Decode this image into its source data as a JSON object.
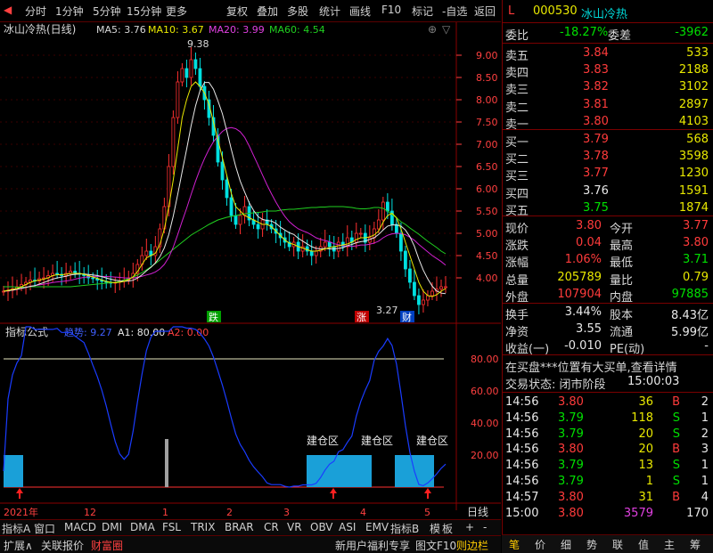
{
  "toolbar": {
    "left": [
      "分时",
      "1分钟",
      "5分钟",
      "15分钟",
      "更多"
    ],
    "right": [
      "复权",
      "叠加",
      "多股",
      "统计",
      "画线",
      "F10",
      "标记",
      "-自选",
      "返回"
    ]
  },
  "main_chart": {
    "title": "冰山冷热(日线)",
    "ma5": "MA5: 3.76",
    "ma10": "MA10: 3.67",
    "ma20": "MA20: 3.99",
    "ma60": "MA60: 4.54",
    "high_label": "9.38",
    "low_label": "3.27",
    "y_ticks": [
      "9.00",
      "8.50",
      "8.00",
      "7.50",
      "7.00",
      "6.50",
      "6.00",
      "5.50",
      "5.00",
      "4.50",
      "4.00"
    ],
    "markers": [
      "跌",
      "涨",
      "财"
    ]
  },
  "indicator": {
    "title": "指标公式",
    "v1": "趋势: 9.27",
    "v2": "A1: 80.00",
    "v3": "A2: 0.00",
    "y_ticks": [
      "80.00",
      "60.00",
      "40.00",
      "20.00"
    ],
    "build_label": "建仓区"
  },
  "x_axis": {
    "labels": [
      "2021年",
      "12",
      "1",
      "2",
      "3",
      "4",
      "5"
    ],
    "right": "日线"
  },
  "chart_data": {
    "type": "line",
    "series": [
      {
        "close": [
          3.7,
          3.72,
          3.75,
          3.8,
          3.85,
          3.9,
          3.95,
          3.93,
          3.98,
          4.0,
          4.05,
          4.1,
          4.08,
          4.05,
          4.1,
          4.15,
          4.1,
          4.08,
          4.05,
          4.0,
          3.98,
          3.95,
          3.92,
          3.9,
          3.88,
          3.9,
          3.92,
          3.95,
          4.0,
          4.1,
          4.3,
          4.5,
          4.6,
          4.5,
          4.7,
          5.1,
          5.6,
          6.5,
          7.6,
          8.4,
          8.7,
          8.5,
          8.9,
          8.7,
          8.3,
          8.0,
          7.6,
          7.2,
          6.6,
          6.2,
          5.8,
          5.4,
          5.2,
          5.4,
          5.6,
          5.3,
          5.2,
          5.1,
          5.3,
          5.2,
          5.1,
          5.0,
          4.9,
          4.8,
          4.7,
          4.8,
          4.6,
          4.7,
          4.6,
          4.5,
          4.6,
          4.7,
          4.8,
          4.7,
          4.6,
          4.8,
          4.7,
          4.9,
          4.8,
          5.0,
          5.0,
          4.8,
          4.9,
          5.1,
          5.3,
          5.7,
          5.5,
          5.2,
          5.0,
          4.6,
          4.2,
          3.9,
          3.6,
          3.4,
          3.5,
          3.6,
          3.7,
          3.75,
          3.8,
          3.8
        ]
      },
      {
        "ma5": [
          3.7,
          3.72,
          3.74,
          3.76,
          3.8,
          3.85,
          3.9,
          3.93,
          3.95,
          3.97,
          4.0,
          4.05,
          4.07,
          4.07,
          4.08,
          4.1,
          4.1,
          4.1,
          4.08,
          4.05,
          4.02,
          3.99,
          3.95,
          3.92,
          3.9,
          3.89,
          3.9,
          3.92,
          3.96,
          4.02,
          4.14,
          4.3,
          4.45,
          4.5,
          4.55,
          4.75,
          5.1,
          5.6,
          6.2,
          6.9,
          7.6,
          8.0,
          8.3,
          8.4,
          8.3,
          8.15,
          7.9,
          7.5,
          7.1,
          6.7,
          6.3,
          5.9,
          5.6,
          5.5,
          5.4,
          5.35,
          5.3,
          5.25,
          5.2,
          5.2,
          5.15,
          5.05,
          4.95,
          4.85,
          4.78,
          4.75,
          4.7,
          4.67,
          4.63,
          4.6,
          4.6,
          4.62,
          4.65,
          4.68,
          4.7,
          4.72,
          4.74,
          4.76,
          4.8,
          4.86,
          4.9,
          4.9,
          4.92,
          4.96,
          5.05,
          5.25,
          5.4,
          5.45,
          5.35,
          5.1,
          4.8,
          4.5,
          4.2,
          3.9,
          3.7,
          3.6,
          3.58,
          3.62,
          3.7,
          3.76
        ]
      },
      {
        "ma60": [
          3.8,
          3.8,
          3.8,
          3.79,
          3.79,
          3.79,
          3.8,
          3.8,
          3.8,
          3.8,
          3.8,
          3.8,
          3.8,
          3.8,
          3.8,
          3.8,
          3.81,
          3.82,
          3.83,
          3.84,
          3.85,
          3.86,
          3.87,
          3.88,
          3.89,
          3.9,
          3.92,
          3.95,
          3.98,
          4.02,
          4.06,
          4.12,
          4.18,
          4.25,
          4.32,
          4.4,
          4.48,
          4.56,
          4.64,
          4.72,
          4.8,
          4.88,
          4.96,
          5.02,
          5.08,
          5.14,
          5.2,
          5.25,
          5.3,
          5.33,
          5.36,
          5.38,
          5.4,
          5.42,
          5.44,
          5.45,
          5.46,
          5.47,
          5.48,
          5.5,
          5.5,
          5.5,
          5.52,
          5.53,
          5.54,
          5.54,
          5.55,
          5.56,
          5.57,
          5.58,
          5.58,
          5.59,
          5.59,
          5.6,
          5.6,
          5.6,
          5.6,
          5.59,
          5.58,
          5.56,
          5.55,
          5.55,
          5.56,
          5.58,
          5.58,
          5.56,
          5.5,
          5.42,
          5.35,
          5.26,
          5.2,
          5.12,
          5.05,
          4.98,
          4.9,
          4.82,
          4.75,
          4.68,
          4.6,
          4.54
        ]
      }
    ],
    "ylim": [
      3.2,
      9.6
    ]
  },
  "quote": {
    "code": "000530",
    "name": "冰山冷热",
    "flag": "L",
    "wb_label": "委比",
    "wb": "-18.27%",
    "wc_label": "委差",
    "wc": "-3962",
    "sell": [
      {
        "label": "卖五",
        "price": "3.84",
        "vol": "533"
      },
      {
        "label": "卖四",
        "price": "3.83",
        "vol": "2188"
      },
      {
        "label": "卖三",
        "price": "3.82",
        "vol": "3102"
      },
      {
        "label": "卖二",
        "price": "3.81",
        "vol": "2897"
      },
      {
        "label": "卖一",
        "price": "3.80",
        "vol": "4103"
      }
    ],
    "buy": [
      {
        "label": "买一",
        "price": "3.79",
        "vol": "568"
      },
      {
        "label": "买二",
        "price": "3.78",
        "vol": "3598"
      },
      {
        "label": "买三",
        "price": "3.77",
        "vol": "1230"
      },
      {
        "label": "买四",
        "price": "3.76",
        "vol": "1591"
      },
      {
        "label": "买五",
        "price": "3.75",
        "vol": "1874"
      }
    ],
    "stats": [
      {
        "l1": "现价",
        "v1": "3.80",
        "l2": "今开",
        "v2": "3.77"
      },
      {
        "l1": "涨跌",
        "v1": "0.04",
        "l2": "最高",
        "v2": "3.80"
      },
      {
        "l1": "涨幅",
        "v1": "1.06%",
        "l2": "最低",
        "v2": "3.71"
      },
      {
        "l1": "总量",
        "v1": "205789",
        "l2": "量比",
        "v2": "0.79"
      },
      {
        "l1": "外盘",
        "v1": "107904",
        "l2": "内盘",
        "v2": "97885"
      }
    ],
    "stats2": [
      {
        "l1": "换手",
        "v1": "3.44%",
        "l2": "股本",
        "v2": "8.43亿"
      },
      {
        "l1": "净资",
        "v1": "3.55",
        "l2": "流通",
        "v2": "5.99亿"
      },
      {
        "l1": "收益(一)",
        "v1": "-0.010",
        "l2": "PE(动)",
        "v2": "-"
      }
    ],
    "notice": "在买盘***位置有大买单,查看详情",
    "status_label": "交易状态: 闭市阶段",
    "status_time": "15:00:03",
    "ticks": [
      {
        "t": "14:56",
        "p": "3.80",
        "v": "36",
        "d": "B",
        "n": "2"
      },
      {
        "t": "14:56",
        "p": "3.79",
        "v": "118",
        "d": "S",
        "n": "1"
      },
      {
        "t": "14:56",
        "p": "3.79",
        "v": "20",
        "d": "S",
        "n": "2"
      },
      {
        "t": "14:56",
        "p": "3.80",
        "v": "20",
        "d": "B",
        "n": "3"
      },
      {
        "t": "14:56",
        "p": "3.79",
        "v": "13",
        "d": "S",
        "n": "1"
      },
      {
        "t": "14:56",
        "p": "3.79",
        "v": "1",
        "d": "S",
        "n": "1"
      },
      {
        "t": "14:57",
        "p": "3.80",
        "v": "31",
        "d": "B",
        "n": "4"
      },
      {
        "t": "15:00",
        "p": "3.80",
        "v": "3579",
        "d": "",
        "n": "170"
      }
    ],
    "bottom_tabs": [
      "笔",
      "价",
      "细",
      "势",
      "联",
      "值",
      "主",
      "筹"
    ]
  },
  "bottom": {
    "row1": [
      "指标A",
      "窗口",
      "MACD",
      "DMI",
      "DMA",
      "FSL",
      "TRIX",
      "BRAR",
      "CR",
      "VR",
      "OBV",
      "ASI",
      "EMV"
    ],
    "row1_right": [
      "指标B",
      "模",
      "板",
      "+",
      "-"
    ],
    "row2": [
      "扩展∧",
      "关联报价",
      "财富圈"
    ],
    "row2_right": [
      "新用户福利专享",
      "图文F10",
      "则边栏"
    ]
  }
}
